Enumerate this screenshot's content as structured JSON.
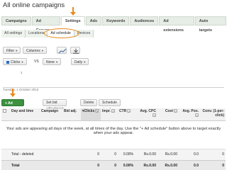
{
  "page": {
    "title": "All online campaigns"
  },
  "tabs": [
    {
      "label": "Campaigns"
    },
    {
      "label": "Ad Groups"
    },
    {
      "label": "Settings"
    },
    {
      "label": "Ads"
    },
    {
      "label": "Keywords"
    },
    {
      "label": "Audiences"
    },
    {
      "label": "Ad extensions"
    },
    {
      "label": "Auto targets"
    }
  ],
  "subtabs": [
    {
      "label": "All settings"
    },
    {
      "label": "Locations"
    },
    {
      "label": "Ad schedule"
    },
    {
      "label": "Devices"
    }
  ],
  "toolbar": {
    "filter": "Filter",
    "columns": "Columns",
    "caret": "▾",
    "metric1": "Clicks",
    "vs": "VS",
    "metric2": "None",
    "period": "Daily"
  },
  "chart": {
    "ytick": "1",
    "xlabel": "Tuesday, 1 October 2013"
  },
  "actions": {
    "add_schedule": "+ Ad schedule",
    "set_bid": "Set bid adjustment",
    "delete": "Delete",
    "schedule_details": "Schedule details"
  },
  "table": {
    "headers": {
      "day_time": "Day and time",
      "campaign": "Campaign",
      "bid_adj": "Bid adj.",
      "clicks": "Clicks",
      "impr": "Impr.",
      "ctr": "CTR",
      "avg_cpc": "Avg. CPC",
      "cost": "Cost",
      "avg_pos": "Avg. Pos.",
      "conv": "Conv. (1-per-click)"
    },
    "message": "Your ads are appearing all days of the week, at all times of the day. Use the \"+ Ad schedule\" button above to target exactly when your ads appear.",
    "deleted_row": {
      "label": "Total - deleted",
      "clicks": "0",
      "impr": "0",
      "ctr": "0.00%",
      "avg_cpc": "Rs.0.00",
      "cost": "Rs.0.00",
      "avg_pos": "0.0",
      "conv": "0"
    },
    "total_row": {
      "label": "Total",
      "clicks": "0",
      "impr": "0",
      "ctr": "0.00%",
      "avg_cpc": "Rs.0.00",
      "cost": "Rs.0.00",
      "avg_pos": "0.0",
      "conv": "0"
    }
  },
  "icons": {
    "chart_icon": "line-chart-icon",
    "download_icon": "download-icon",
    "help_icon": "help-icon"
  },
  "colors": {
    "accent_orange": "#e8891c",
    "add_button_green": "#3d9140",
    "series_blue": "#2a6ebb"
  }
}
